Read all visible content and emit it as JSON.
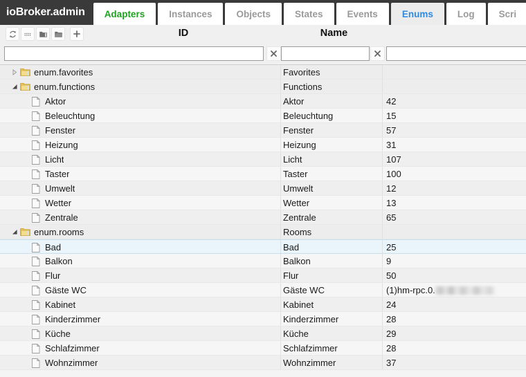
{
  "app": {
    "brand": "ioBroker.admin",
    "accent_green": "#21a121",
    "accent_blue": "#2f8ae0",
    "titlebar_bg": "#3a3a3a"
  },
  "tabs": [
    {
      "label": "Adapters",
      "state": "adapters"
    },
    {
      "label": "Instances",
      "state": "normal"
    },
    {
      "label": "Objects",
      "state": "normal"
    },
    {
      "label": "States",
      "state": "normal"
    },
    {
      "label": "Events",
      "state": "normal"
    },
    {
      "label": "Enums",
      "state": "active"
    },
    {
      "label": "Log",
      "state": "normal"
    },
    {
      "label": "Scri",
      "state": "normal"
    }
  ],
  "toolbar": {
    "buttons": [
      {
        "icon": "refresh-icon",
        "title": "Refresh"
      },
      {
        "icon": "list-icon",
        "title": "List"
      },
      {
        "icon": "folder-closed-icon",
        "title": "Collapse all"
      },
      {
        "icon": "folder-open-icon",
        "title": "Expand all"
      },
      {
        "icon": "plus-icon",
        "title": "Add"
      }
    ]
  },
  "columns": {
    "id": "ID",
    "name": "Name",
    "value": ""
  },
  "filters": [
    {
      "name": "id-filter",
      "value": "",
      "placeholder": ""
    },
    {
      "name": "name-filter",
      "value": "",
      "placeholder": ""
    },
    {
      "name": "value-filter",
      "value": "",
      "placeholder": ""
    }
  ],
  "clear_buttons": [
    {
      "name": "clear-id-filter",
      "glyph": "✖"
    },
    {
      "name": "clear-name-filter",
      "glyph": "✖"
    }
  ],
  "rows": [
    {
      "id": "enum.favorites",
      "name": "Favorites",
      "value": "",
      "type": "folder",
      "depth": 1,
      "twisty": "collapsed",
      "selected": false
    },
    {
      "id": "enum.functions",
      "name": "Functions",
      "value": "",
      "type": "folder",
      "depth": 1,
      "twisty": "expanded",
      "selected": false
    },
    {
      "id": "Aktor",
      "name": "Aktor",
      "value": "42",
      "type": "file",
      "depth": 2,
      "twisty": "none",
      "selected": false
    },
    {
      "id": "Beleuchtung",
      "name": "Beleuchtung",
      "value": "15",
      "type": "file",
      "depth": 2,
      "twisty": "none",
      "selected": false
    },
    {
      "id": "Fenster",
      "name": "Fenster",
      "value": "57",
      "type": "file",
      "depth": 2,
      "twisty": "none",
      "selected": false
    },
    {
      "id": "Heizung",
      "name": "Heizung",
      "value": "31",
      "type": "file",
      "depth": 2,
      "twisty": "none",
      "selected": false
    },
    {
      "id": "Licht",
      "name": "Licht",
      "value": "107",
      "type": "file",
      "depth": 2,
      "twisty": "none",
      "selected": false
    },
    {
      "id": "Taster",
      "name": "Taster",
      "value": "100",
      "type": "file",
      "depth": 2,
      "twisty": "none",
      "selected": false
    },
    {
      "id": "Umwelt",
      "name": "Umwelt",
      "value": "12",
      "type": "file",
      "depth": 2,
      "twisty": "none",
      "selected": false
    },
    {
      "id": "Wetter",
      "name": "Wetter",
      "value": "13",
      "type": "file",
      "depth": 2,
      "twisty": "none",
      "selected": false
    },
    {
      "id": "Zentrale",
      "name": "Zentrale",
      "value": "65",
      "type": "file",
      "depth": 2,
      "twisty": "none",
      "selected": false
    },
    {
      "id": "enum.rooms",
      "name": "Rooms",
      "value": "",
      "type": "folder",
      "depth": 1,
      "twisty": "expanded",
      "selected": false
    },
    {
      "id": "Bad",
      "name": "Bad",
      "value": "25",
      "type": "file",
      "depth": 2,
      "twisty": "none",
      "selected": true
    },
    {
      "id": "Balkon",
      "name": "Balkon",
      "value": "9",
      "type": "file",
      "depth": 2,
      "twisty": "none",
      "selected": false
    },
    {
      "id": "Flur",
      "name": "Flur",
      "value": "50",
      "type": "file",
      "depth": 2,
      "twisty": "none",
      "selected": false
    },
    {
      "id": "Gäste WC",
      "name": "Gäste WC",
      "value": "(1)hm-rpc.0.",
      "value_redacted": true,
      "type": "file",
      "depth": 2,
      "twisty": "none",
      "selected": false
    },
    {
      "id": "Kabinet",
      "name": "Kabinet",
      "value": "24",
      "type": "file",
      "depth": 2,
      "twisty": "none",
      "selected": false
    },
    {
      "id": "Kinderzimmer",
      "name": "Kinderzimmer",
      "value": "28",
      "type": "file",
      "depth": 2,
      "twisty": "none",
      "selected": false
    },
    {
      "id": "Küche",
      "name": "Küche",
      "value": "29",
      "type": "file",
      "depth": 2,
      "twisty": "none",
      "selected": false
    },
    {
      "id": "Schlafzimmer",
      "name": "Schlafzimmer",
      "value": "28",
      "type": "file",
      "depth": 2,
      "twisty": "none",
      "selected": false
    },
    {
      "id": "Wohnzimmer",
      "name": "Wohnzimmer",
      "value": "37",
      "type": "file",
      "depth": 2,
      "twisty": "none",
      "selected": false
    }
  ]
}
